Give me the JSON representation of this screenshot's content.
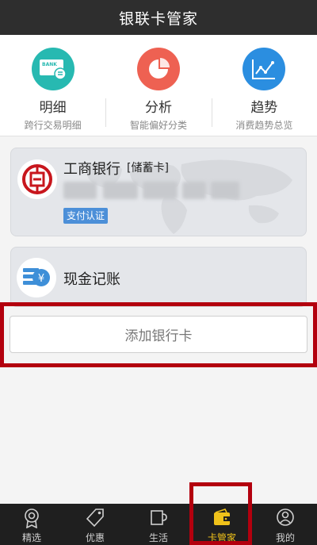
{
  "header": {
    "title": "银联卡管家"
  },
  "features": [
    {
      "title": "明细",
      "subtitle": "跨行交易明细",
      "icon": "bank-card-icon",
      "color": "#27b9b1",
      "icon_text": "BANK"
    },
    {
      "title": "分析",
      "subtitle": "智能偏好分类",
      "icon": "pie-chart-icon",
      "color": "#ee6152"
    },
    {
      "title": "趋势",
      "subtitle": "消费趋势总览",
      "icon": "trend-chart-icon",
      "color": "#2b8ee0"
    }
  ],
  "bank_card": {
    "bank_name": "工商银行",
    "card_type": "[储蓄卡]",
    "badge": "支付认证",
    "logo_icon": "icbc-logo-icon",
    "brand_color": "#c8161d"
  },
  "cash_card": {
    "label": "现金记账",
    "icon": "cash-note-icon"
  },
  "add_button": {
    "label": "添加银行卡"
  },
  "tabbar": {
    "items": [
      {
        "label": "精选",
        "icon": "badge-icon"
      },
      {
        "label": "优惠",
        "icon": "tag-icon"
      },
      {
        "label": "生活",
        "icon": "cup-icon"
      },
      {
        "label": "卡管家",
        "icon": "wallet-icon",
        "active": true
      },
      {
        "label": "我的",
        "icon": "user-icon"
      }
    ],
    "active_color": "#f0c21a"
  },
  "highlight_color": "#b3000e"
}
